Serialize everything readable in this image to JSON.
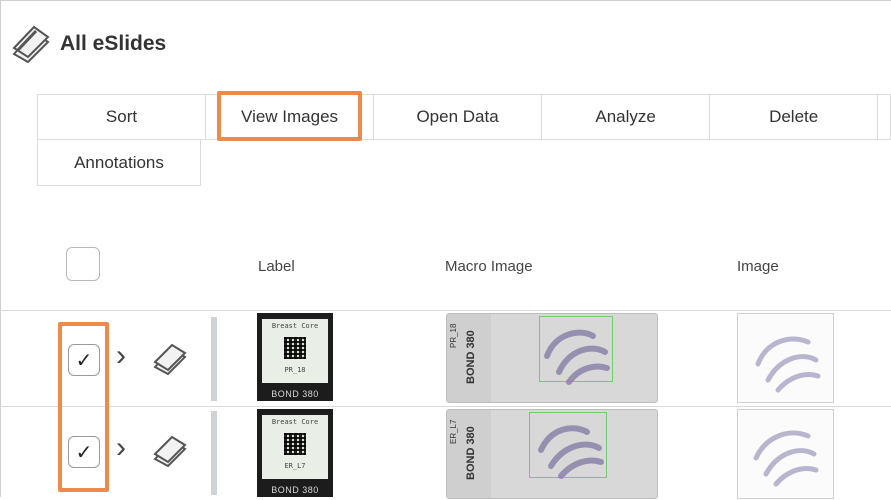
{
  "page": {
    "title": "All eSlides",
    "logo_icon": "slides-stack-icon"
  },
  "toolbar": {
    "row1": [
      "Sort",
      "View Images",
      "Open Data",
      "Analyze",
      "Delete",
      ""
    ],
    "row2": [
      "Annotations"
    ]
  },
  "columns": {
    "label": "Label",
    "macro": "Macro Image",
    "image": "Image"
  },
  "rows": [
    {
      "checked": true,
      "check_glyph": "✓",
      "label_line1": "Breast Core",
      "label_line2": "PR_18",
      "label_footer": "BOND 380",
      "macro_tag": "PR_18",
      "macro_bond": "BOND 380"
    },
    {
      "checked": true,
      "check_glyph": "✓",
      "label_line1": "Breast Core",
      "label_line2": "ER_L7",
      "label_footer": "BOND 380",
      "macro_tag": "ER_L7",
      "macro_bond": "BOND 380"
    }
  ],
  "colors": {
    "highlight": "#f08a4a",
    "roi": "#6ccf6c",
    "tissue": "#8a84a8"
  }
}
